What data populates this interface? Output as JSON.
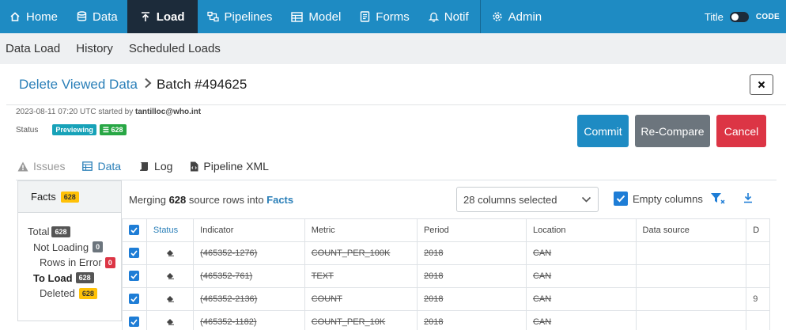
{
  "nav": {
    "items": [
      {
        "label": "Home",
        "icon": "home-icon"
      },
      {
        "label": "Data",
        "icon": "database-icon"
      },
      {
        "label": "Load",
        "icon": "upload-icon",
        "active": true
      },
      {
        "label": "Pipelines",
        "icon": "pipelines-icon"
      },
      {
        "label": "Model",
        "icon": "model-icon"
      },
      {
        "label": "Forms",
        "icon": "forms-icon"
      },
      {
        "label": "Notif",
        "icon": "bell-icon"
      },
      {
        "label": "Admin",
        "icon": "gear-icon"
      }
    ],
    "title_label": "Title",
    "code_label": "CODE"
  },
  "subnav": {
    "items": [
      "Data Load",
      "History",
      "Scheduled Loads"
    ]
  },
  "breadcrumb": {
    "parent": "Delete Viewed Data",
    "current": "Batch #494625"
  },
  "meta": {
    "started": "2023-08-11 07:20 UTC started by ",
    "user": "tantilloc@who.int"
  },
  "status": {
    "label": "Status",
    "badge": "Previewing",
    "count": "628"
  },
  "buttons": {
    "commit": "Commit",
    "recompare": "Re-Compare",
    "cancel": "Cancel"
  },
  "tabs": [
    "Issues",
    "Data",
    "Log",
    "Pipeline XML"
  ],
  "facts": {
    "title": "Facts",
    "count": "628",
    "rows": [
      {
        "label": "Total",
        "value": "628"
      },
      {
        "label": "Not Loading",
        "value": "0"
      },
      {
        "label": "Rows in Error",
        "value": "0"
      },
      {
        "label": "To Load",
        "value": "628"
      },
      {
        "label": "Deleted",
        "value": "628"
      }
    ]
  },
  "merge": {
    "prefix": "Merging ",
    "count": "628",
    "middle": " source rows into ",
    "target": "Facts"
  },
  "columns_select": "28 columns selected",
  "empty_columns": "Empty columns",
  "table": {
    "headers": [
      "Status",
      "Indicator",
      "Metric",
      "Period",
      "Location",
      "Data source",
      "D"
    ],
    "rows": [
      {
        "indicator": "(465352-1276)",
        "metric": "COUNT_PER_100K",
        "period": "2018",
        "location": "CAN",
        "datasource": "",
        "extra": ""
      },
      {
        "indicator": "(465352-761)",
        "metric": "TEXT",
        "period": "2018",
        "location": "CAN",
        "datasource": "",
        "extra": ""
      },
      {
        "indicator": "(465352-2136)",
        "metric": "COUNT",
        "period": "2018",
        "location": "CAN",
        "datasource": "",
        "extra": "9"
      },
      {
        "indicator": "(465352-1182)",
        "metric": "COUNT_PER_10K",
        "period": "2018",
        "location": "CAN",
        "datasource": "",
        "extra": ""
      }
    ]
  }
}
